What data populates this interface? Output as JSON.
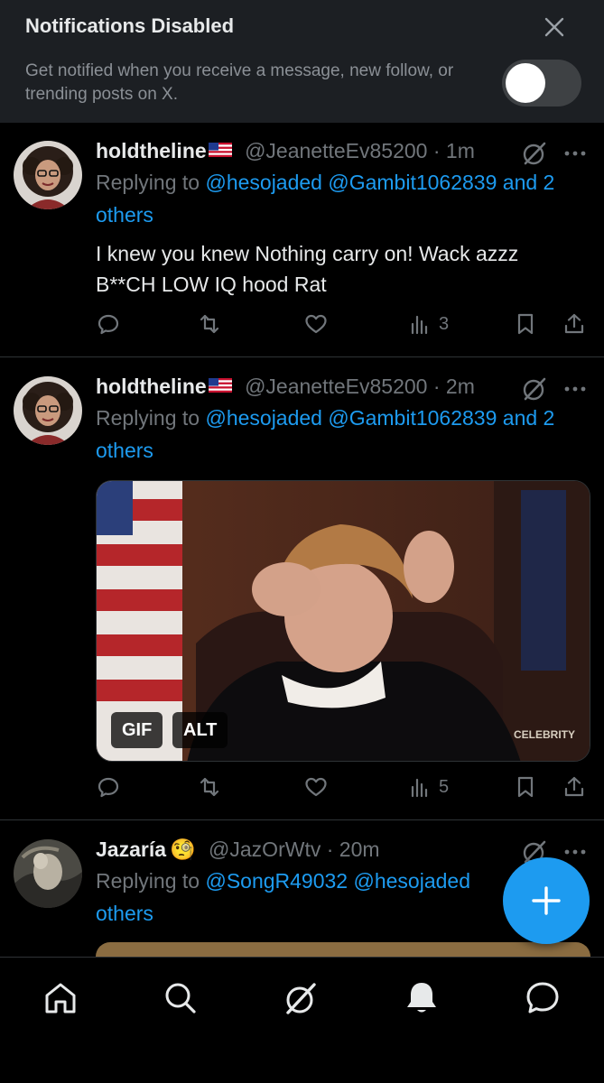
{
  "banner": {
    "title": "Notifications Disabled",
    "text": "Get notified when you receive a message, new follow, or trending posts on X.",
    "close_icon": "close-icon",
    "toggle_state": "off"
  },
  "posts": [
    {
      "name": "holdtheline",
      "flag": "🇺🇸",
      "handle": "@JeanetteEv85200",
      "time": "1m",
      "replying_prefix": "Replying to",
      "mention_1": "@hesojaded",
      "mention_2": "@Gambit1062839",
      "and_others": "and",
      "others": "2 others",
      "text": "I knew you knew Nothing carry on! Wack azzz B**CH LOW IQ hood Rat",
      "views": "3"
    },
    {
      "name": "holdtheline",
      "flag": "🇺🇸",
      "handle": "@JeanetteEv85200",
      "time": "2m",
      "replying_prefix": "Replying to",
      "mention_1": "@hesojaded",
      "mention_2": "@Gambit1062839",
      "and_others": "and",
      "others": "2 others",
      "media_badge_gif": "GIF",
      "media_badge_alt": "ALT",
      "media_watermark": "CELEBRITY",
      "views": "5"
    },
    {
      "name": "Jazaría",
      "emoji": "🧐",
      "handle": "@JazOrWtv",
      "time": "20m",
      "replying_prefix": "Replying to",
      "mention_1": "@SongR49032",
      "mention_2": "@hesojaded",
      "others": "others"
    }
  ],
  "colors": {
    "accent": "#1d9bf0",
    "muted": "#71767b",
    "banner_bg": "#1c1f23"
  },
  "nav": [
    "home-icon",
    "search-icon",
    "grok-icon",
    "notifications-icon",
    "messages-icon"
  ],
  "fab_icon": "plus-icon"
}
